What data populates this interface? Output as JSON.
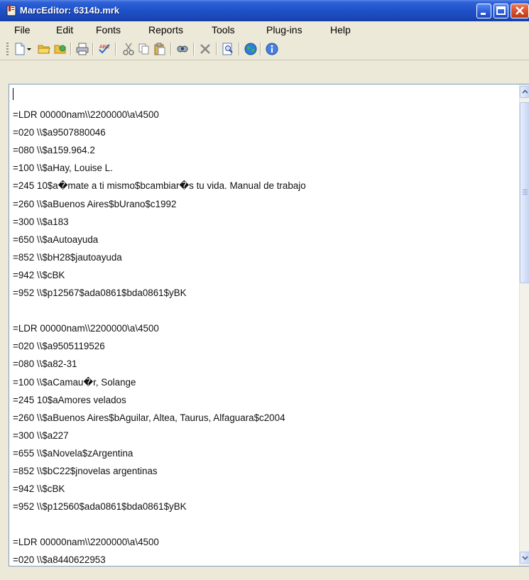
{
  "window": {
    "title": "MarcEditor: 6314b.mrk"
  },
  "menu": [
    "File",
    "Edit",
    "Fonts",
    "Reports",
    "Tools",
    "Plug-ins",
    "Help"
  ],
  "toolbar": {
    "icons": [
      "new-document-icon",
      "dropdown-arrow-icon",
      "open-folder-icon",
      "open-recent-icon",
      "print-icon",
      "spellcheck-icon",
      "cut-icon",
      "copy-icon",
      "paste-icon",
      "find-icon",
      "delete-icon",
      "preview-icon",
      "web-globe-icon",
      "info-icon"
    ]
  },
  "editor": {
    "lines": [
      "",
      "=LDR  00000nam\\\\2200000\\a\\4500",
      "=020  \\\\$a9507880046",
      "=080  \\\\$a159.964.2",
      "=100  \\\\$aHay, Louise L.",
      "=245  10$a�mate a ti mismo$bcambiar�s tu vida. Manual de trabajo",
      "=260  \\\\$aBuenos Aires$bUrano$c1992",
      "=300  \\\\$a183",
      "=650  \\\\$aAutoayuda",
      "=852  \\\\$bH28$jautoayuda",
      "=942  \\\\$cBK",
      "=952  \\\\$p12567$ada0861$bda0861$yBK",
      "",
      "=LDR  00000nam\\\\2200000\\a\\4500",
      "=020  \\\\$a9505119526",
      "=080  \\\\$a82-31",
      "=100  \\\\$aCamau�r, Solange",
      "=245  10$aAmores velados",
      "=260  \\\\$aBuenos Aires$bAguilar, Altea, Taurus, Alfaguara$c2004",
      "=300  \\\\$a227",
      "=655  \\\\$aNovela$zArgentina",
      "=852  \\\\$bC22$jnovelas argentinas",
      "=942  \\\\$cBK",
      "=952  \\\\$p12560$ada0861$bda0861$yBK",
      "",
      "=LDR  00000nam\\\\2200000\\a\\4500",
      "=020  \\\\$a8440622953"
    ]
  }
}
